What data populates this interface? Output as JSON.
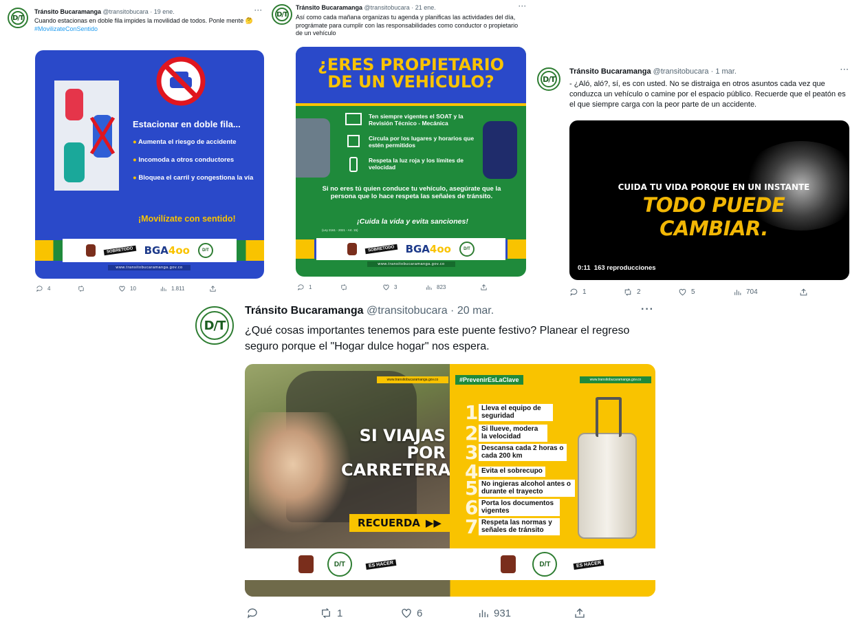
{
  "tweets": [
    {
      "name": "Tránsito Bucaramanga",
      "handle": "@transitobucara",
      "dot": "·",
      "date": "19 ene.",
      "more": "···",
      "text": "Cuando estacionas en doble fila impides la movilidad de todos. Ponle mente 🤔",
      "hashtag": "#MovilizateConSentido",
      "media": {
        "heading": "Estacionar en doble fila...",
        "bullets": [
          "Aumenta el riesgo de accidente",
          "Incomoda a otros conductores",
          "Bloquea el carril y congestiona la vía"
        ],
        "cta": "¡Movilízate con sentido!",
        "url": "www.transitobucaramanga.gov.co"
      },
      "stats": {
        "replies": "4",
        "retweets": "",
        "likes": "10",
        "views": "1.811"
      }
    },
    {
      "name": "Tránsito Bucaramanga",
      "handle": "@transitobucara",
      "dot": "·",
      "date": "21 ene.",
      "more": "···",
      "text": "Así como cada mañana organizas tu agenda y planificas las actividades del día, prográmate para cumplir con las responsabilidades como conductor o propietario de un vehículo",
      "media": {
        "headline": "¿ERES PROPIETARIO DE UN VEHÍCULO?",
        "items": [
          "Ten siempre vigentes el SOAT y la Revisión Técnico - Mecánica",
          "Circula por los lugares y horarios que estén permitidos",
          "Respeta la luz roja y los límites de velocidad"
        ],
        "note": "Si no eres tú quien conduce tu vehículo, asegúrate que la persona que lo hace respeta las señales de tránsito.",
        "cta": "¡Cuida la vida y evita sanciones!",
        "law": "(Ley 2161 - 2021 - Art. 15)",
        "url": "www.transitobucaramanga.gov.co"
      },
      "stats": {
        "replies": "1",
        "retweets": "",
        "likes": "3",
        "views": "823"
      }
    },
    {
      "name": "Tránsito Bucaramanga",
      "handle": "@transitobucara",
      "dot": "·",
      "date": "1 mar.",
      "more": "···",
      "text": "- ¿Aló, aló?, sí, es con usted. No se distraiga en otros asuntos cada vez que conduzca un vehículo o camine por el espacio público. Recuerde que el peatón es el que siempre carga con la peor parte de un accidente.",
      "media": {
        "line1": "CUIDA TU VIDA PORQUE EN UN INSTANTE",
        "line2": "TODO PUEDE CAMBIAR.",
        "time": "0:11",
        "plays": "163 reproducciones"
      },
      "stats": {
        "replies": "1",
        "retweets": "2",
        "likes": "5",
        "views": "704"
      }
    },
    {
      "name": "Tránsito Bucaramanga",
      "handle": "@transitobucara",
      "dot": "·",
      "date": "20 mar.",
      "more": "···",
      "text": "¿Qué cosas importantes tenemos para este puente festivo? Planear el regreso seguro porque el \"Hogar dulce hogar\" nos espera.",
      "media": {
        "left_title": "SI VIAJAS POR CARRETERA",
        "recuerda": "RECUERDA",
        "url": "www.transitobucaramanga.gov.co",
        "hashtag": "#PrevenirEsLaClave",
        "items": [
          {
            "n": "1",
            "t": "Lleva el equipo de seguridad"
          },
          {
            "n": "2",
            "t": "Si llueve, modera la velocidad"
          },
          {
            "n": "3",
            "t": "Descansa cada 2 horas o cada 200 km"
          },
          {
            "n": "4",
            "t": "Evita el sobrecupo"
          },
          {
            "n": "5",
            "t": "No ingieras alcohol antes o durante el trayecto"
          },
          {
            "n": "6",
            "t": "Porta los documentos vigentes"
          },
          {
            "n": "7",
            "t": "Respeta las normas y señales de tránsito"
          }
        ]
      },
      "stats": {
        "replies": "",
        "retweets": "1",
        "likes": "6",
        "views": "931"
      }
    }
  ],
  "brand": {
    "avatar_text": "D/T",
    "bga_a": "BGA",
    "bga_b": "4oo",
    "sobretodo_a": "SOBRETODO",
    "sobretodo_b": "ES HACER",
    "icon_names": [
      "reply-icon",
      "retweet-icon",
      "like-icon",
      "views-icon",
      "share-icon"
    ]
  },
  "colors": {
    "accent": "#1d9bf0",
    "blue": "#2a49c9",
    "green": "#1f8a3b",
    "yellow": "#f9c300",
    "muted": "#536471"
  }
}
